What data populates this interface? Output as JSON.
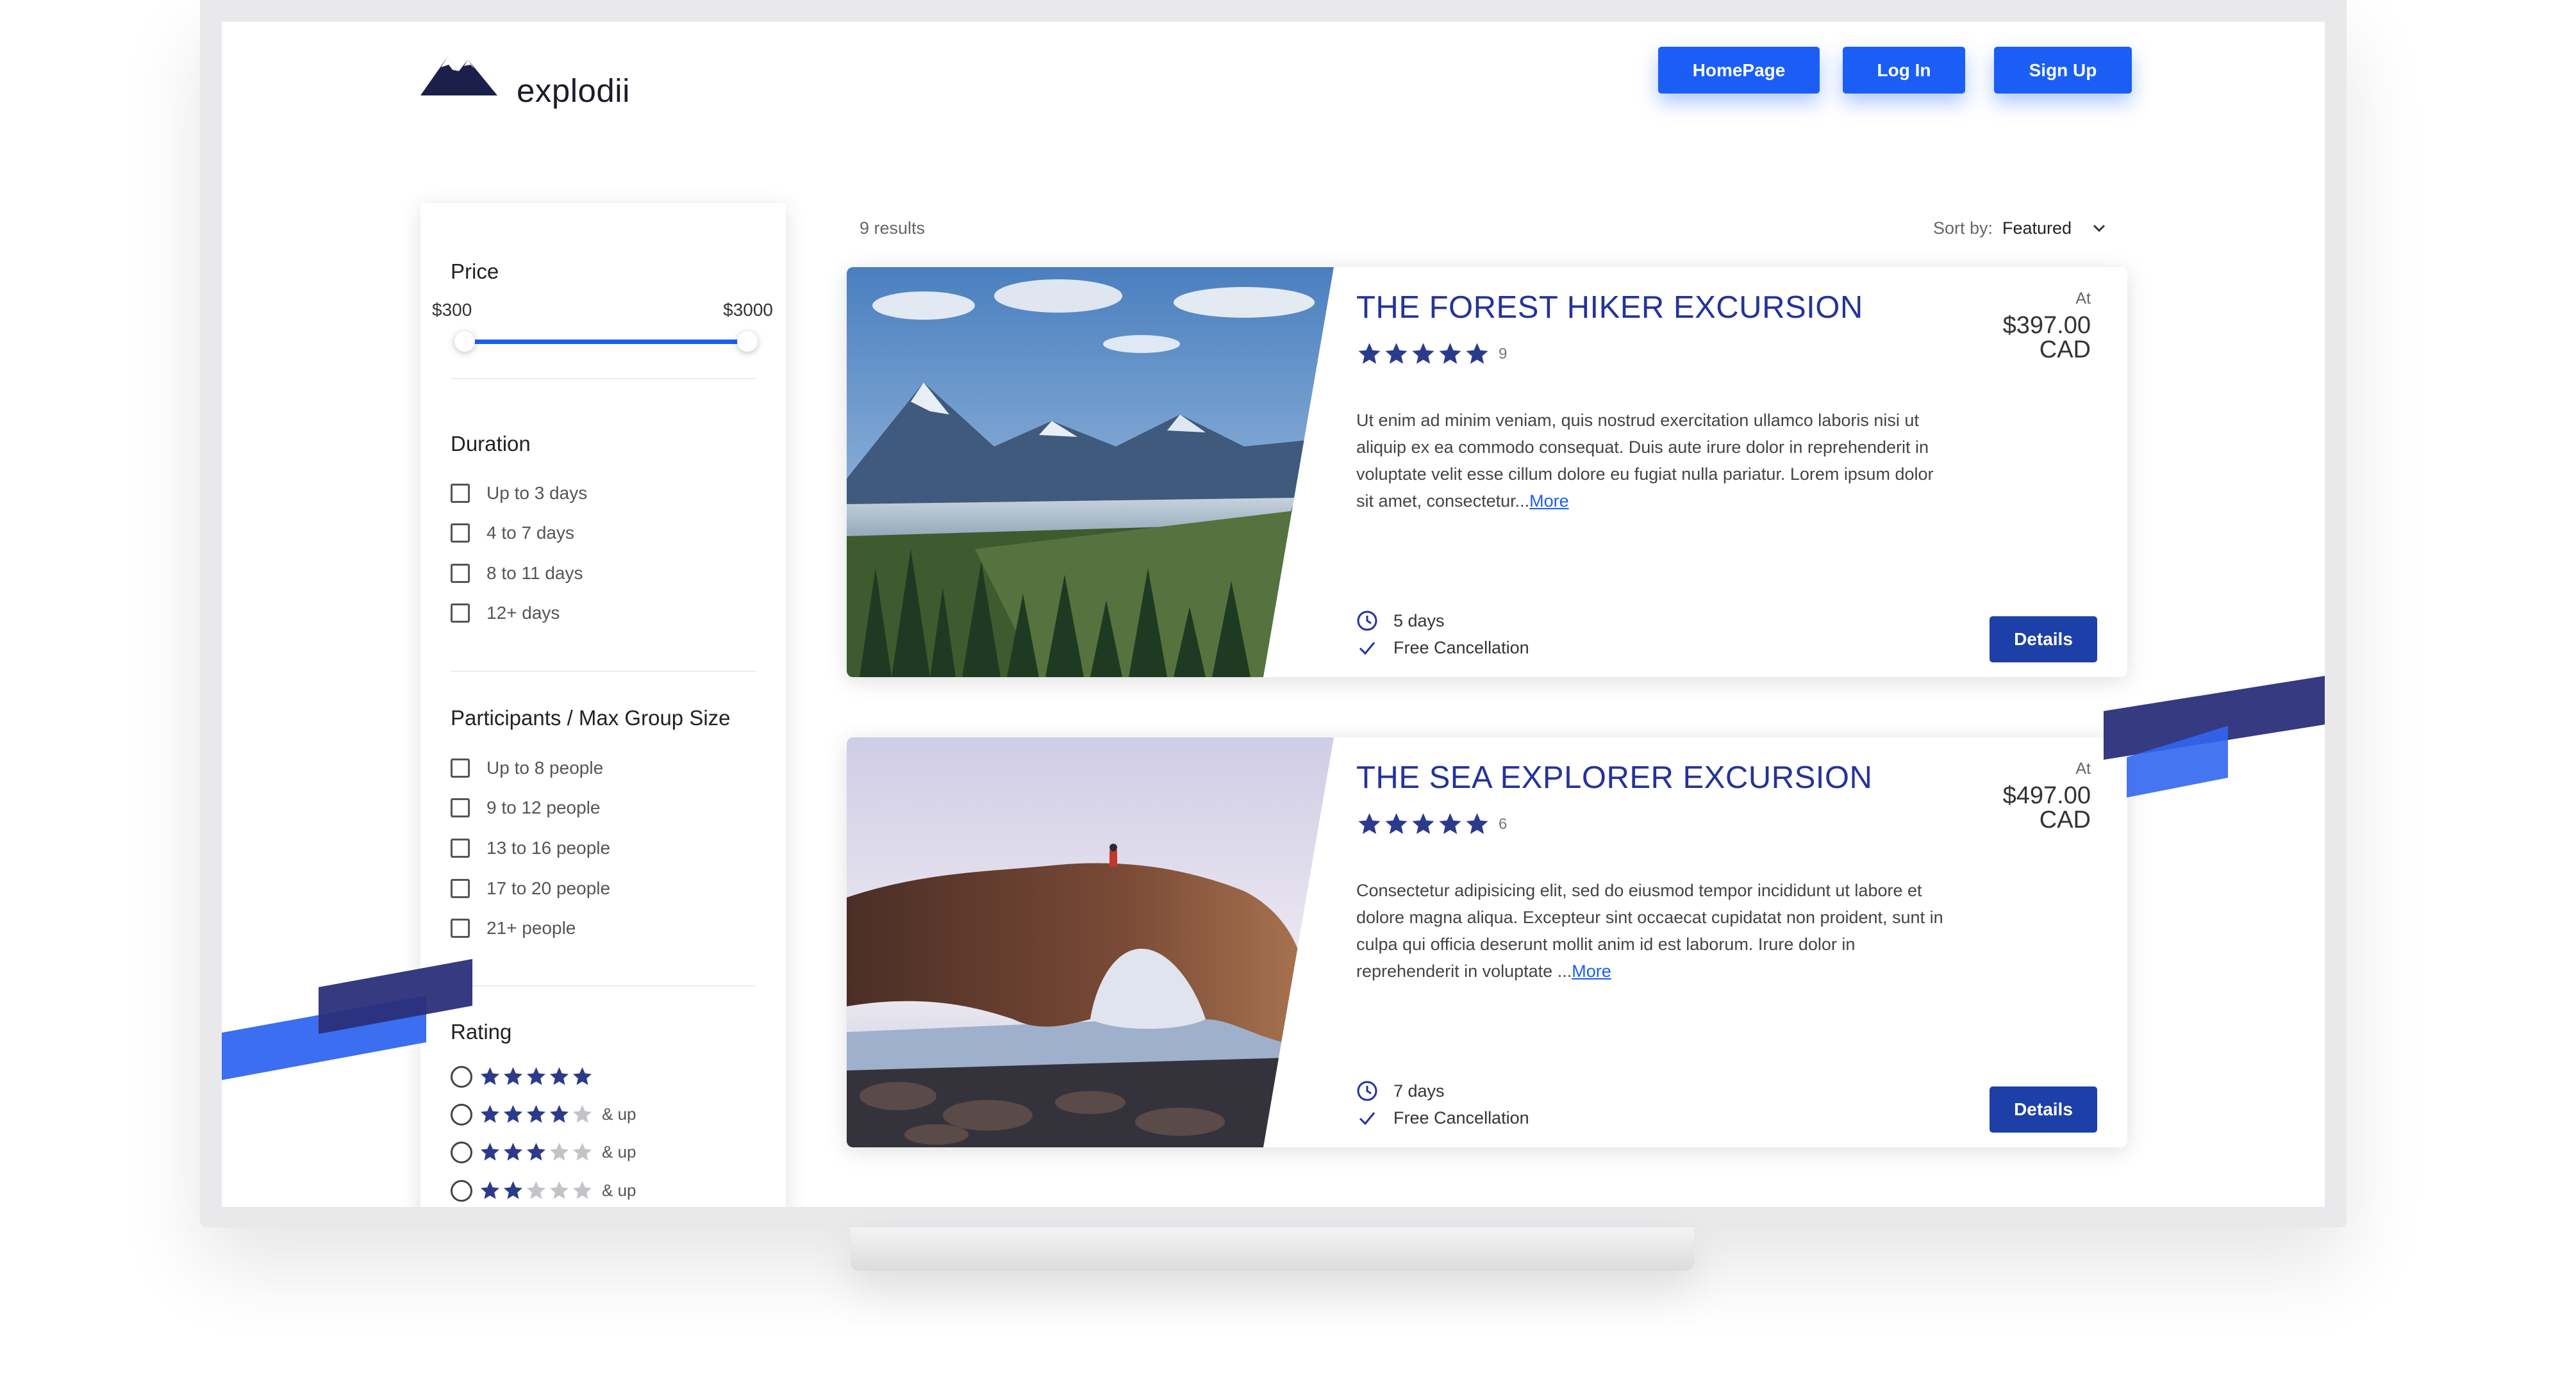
{
  "brand": {
    "name": "explodii"
  },
  "nav": {
    "homepage_label": "HomePage",
    "login_label": "Log In",
    "signup_label": "Sign Up"
  },
  "filters": {
    "price": {
      "title": "Price",
      "min_label": "$300",
      "max_label": "$3000"
    },
    "duration": {
      "title": "Duration",
      "options": [
        "Up to 3 days",
        "4 to 7 days",
        "8 to 11 days",
        "12+ days"
      ]
    },
    "participants": {
      "title": "Participants / Max Group Size",
      "options": [
        "Up to 8 people",
        "9 to 12 people",
        "13 to 16 people",
        "17 to 20 people",
        "21+ people"
      ]
    },
    "rating": {
      "title": "Rating",
      "and_up_label": "& up",
      "options": [
        5,
        4,
        3,
        2
      ]
    }
  },
  "results": {
    "count_label": "9 results",
    "sort_label": "Sort by:",
    "sort_value": "Featured"
  },
  "tours": [
    {
      "title": "THE FOREST HIKER EXCURSION",
      "rating": 5,
      "review_count": "9",
      "description": "Ut enim ad minim veniam, quis nostrud exercitation ullamco laboris nisi ut aliquip ex ea commodo consequat. Duis aute irure dolor in reprehenderit in voluptate velit esse cillum dolore eu fugiat nulla pariatur. Lorem ipsum dolor sit amet, consectetur...",
      "more_label": "More",
      "price_prefix": "At",
      "price_amount": "$397.00",
      "price_currency": "CAD",
      "duration": "5 days",
      "cancellation": "Free Cancellation",
      "details_label": "Details"
    },
    {
      "title": "THE SEA EXPLORER EXCURSION",
      "rating": 5,
      "review_count": "6",
      "description": "Consectetur adipisicing elit, sed do eiusmod tempor incididunt ut labore et dolore magna aliqua. Excepteur sint occaecat cupidatat non proident, sunt in culpa qui officia deserunt mollit anim id est laborum. Irure dolor in reprehenderit in voluptate ...",
      "more_label": "More",
      "price_prefix": "At",
      "price_amount": "$497.00",
      "price_currency": "CAD",
      "duration": "7 days",
      "cancellation": "Free Cancellation",
      "details_label": "Details"
    }
  ],
  "icons": {
    "logo": "mountain-logo-icon",
    "sort": "chevron-down-icon",
    "duration": "clock-icon",
    "cancellation": "checkmark-icon",
    "rating": "star-icon"
  },
  "colors": {
    "accent": "#1a5ef5",
    "title_blue": "#24339a",
    "details_button": "#1d3fa8",
    "star_filled": "#2c3a8c",
    "star_empty": "#c4c4c8",
    "deco_dark": "#2a2f7a",
    "deco_bright": "#3266f0"
  }
}
